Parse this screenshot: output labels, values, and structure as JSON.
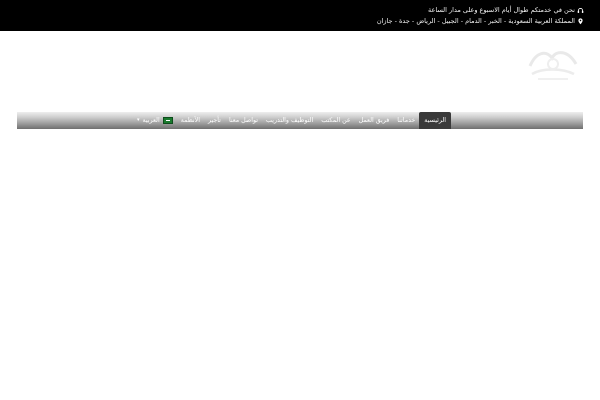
{
  "topbar": {
    "line1_text": "نحن في خدمتكم طوال أيام الاسبوع وعلى مدار الساعة",
    "line1_icon": "support-icon",
    "line2_text": "المملكة العربية السعودية - الخبر - الدمام - الجبيل - الرياض - جدة - جازان",
    "line2_icon": "location-icon"
  },
  "logo": {
    "alt_icon": "company-logo"
  },
  "nav": {
    "items": [
      {
        "label": "الرئيسية",
        "active": true
      },
      {
        "label": "خدماتنا"
      },
      {
        "label": "فريق العمل"
      },
      {
        "label": "عن المكتب"
      },
      {
        "label": "التوظيف والتدريب"
      },
      {
        "label": "تواصل معنا"
      },
      {
        "label": "تأجير"
      },
      {
        "label": "الأنظمة"
      }
    ],
    "language": {
      "label": "العربية",
      "flag_icon": "saudi-flag-icon",
      "caret": "▾"
    }
  },
  "colors": {
    "topbar_bg": "#000000",
    "nav_active_bg": "#3a3a3a"
  }
}
